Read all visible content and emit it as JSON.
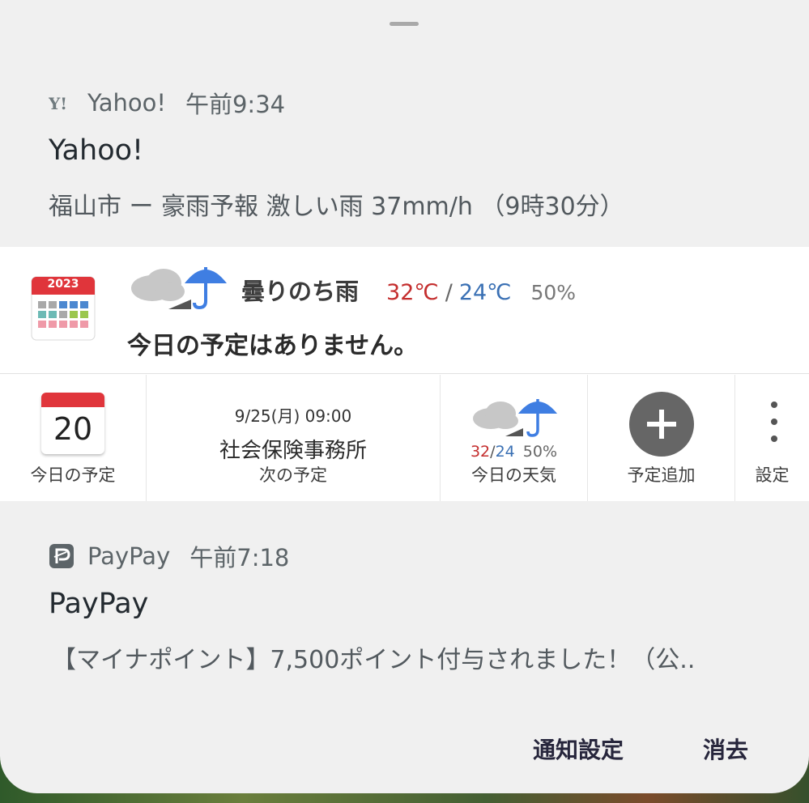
{
  "yahoo": {
    "app_name": "Yahoo!",
    "time": "午前9:34",
    "title": "Yahoo!",
    "body": "福山市 ー 豪雨予報 激しい雨 37mm/h （9時30分）",
    "icon": "yahoo-logo-icon"
  },
  "calendar_widget": {
    "app_icon_year": "2023",
    "weather": {
      "condition": "曇りのち雨",
      "high": "32℃",
      "separator": "/",
      "low": "24℃",
      "precip": "50%"
    },
    "no_schedule": "今日の予定はありません。",
    "cells": {
      "today": {
        "day": "20",
        "label": "今日の予定"
      },
      "next": {
        "date": "9/25(月) 09:00",
        "title": "社会保険事務所",
        "label": "次の予定"
      },
      "weather": {
        "high": "32",
        "sep": "/",
        "low": "24",
        "precip": "50%",
        "label": "今日の天気"
      },
      "add": {
        "label": "予定追加"
      },
      "settings": {
        "label": "設定"
      }
    },
    "colors": {
      "high": "#c42e2e",
      "low": "#3a70b4",
      "umbrella": "#3f7ee2"
    }
  },
  "paypay": {
    "app_name": "PayPay",
    "time": "午前7:18",
    "title": "PayPay",
    "body": "【マイナポイント】7,500ポイント付与されました！（公..",
    "icon": "paypay-logo-icon"
  },
  "actions": {
    "notification_settings": "通知設定",
    "clear": "消去"
  }
}
